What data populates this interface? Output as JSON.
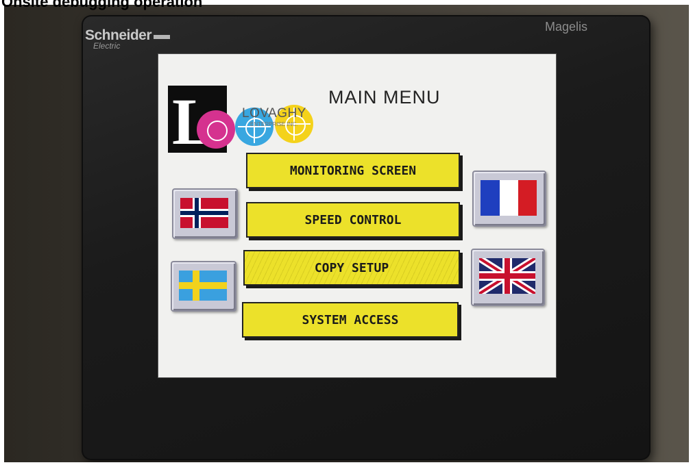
{
  "caption": "Onsite debugging operation",
  "device": {
    "brand": "Schneider",
    "brand_sub": "Electric",
    "model": "Magelis"
  },
  "screen": {
    "company_name": "LOVAGHY",
    "company_sub": "ENTERPRISE INC.",
    "title": "MAIN MENU",
    "menu": [
      {
        "label": "MONITORING SCREEN"
      },
      {
        "label": "SPEED CONTROL"
      },
      {
        "label": "COPY SETUP"
      },
      {
        "label": "SYSTEM ACCESS"
      }
    ],
    "languages": [
      {
        "icon": "norway-flag-icon"
      },
      {
        "icon": "sweden-flag-icon"
      },
      {
        "icon": "france-flag-icon"
      },
      {
        "icon": "uk-flag-icon"
      }
    ]
  },
  "colors": {
    "button_yellow": "#ece12a",
    "screen_bg": "#f1f1ef",
    "bezel": "#1b1b1b"
  }
}
